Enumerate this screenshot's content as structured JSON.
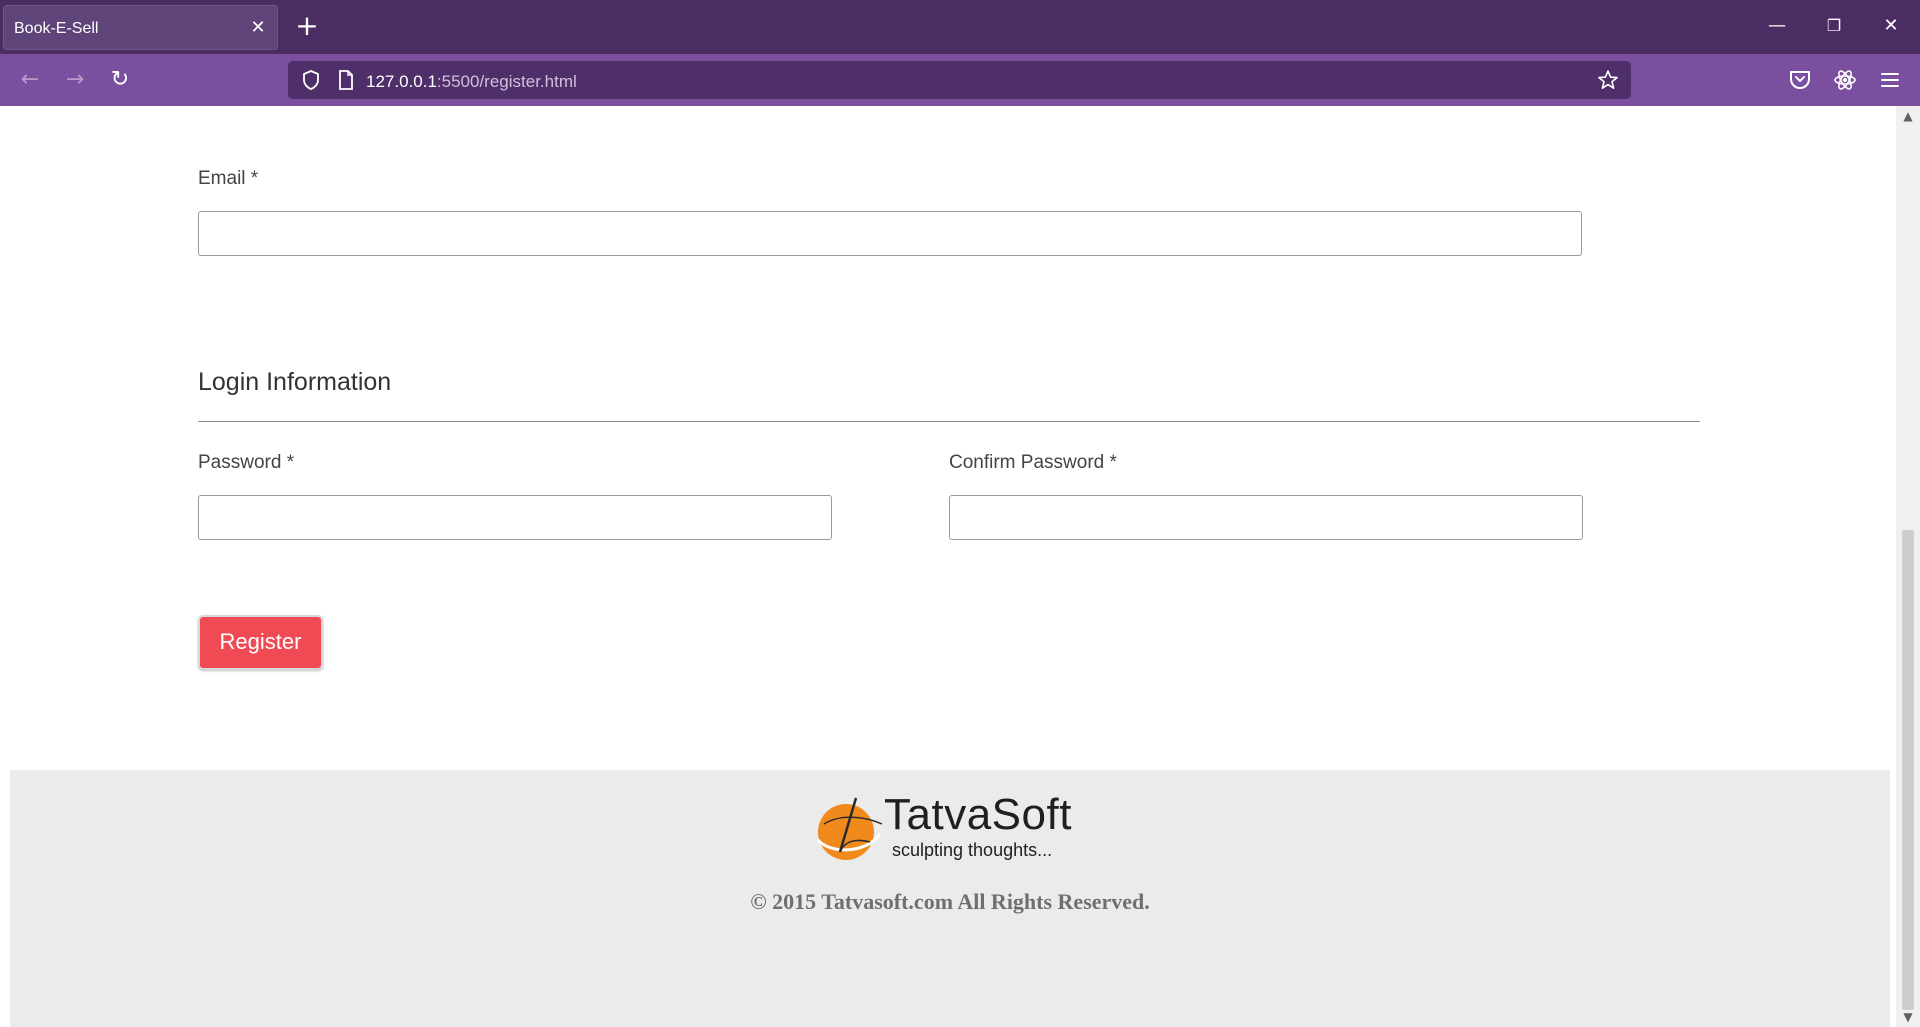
{
  "browser": {
    "tab_title": "Book-E-Sell",
    "tab_close": "✕",
    "new_tab": "+",
    "url_host": "127.0.0.1",
    "url_path": ":5500/register.html",
    "back_icon": "←",
    "forward_icon": "→",
    "reload_icon": "↻",
    "minimize_icon": "—",
    "restore_icon": "❐",
    "close_icon": "✕"
  },
  "form": {
    "email_label": "Email *",
    "email_value": "",
    "login_section_title": "Login Information",
    "password_label": "Password *",
    "password_value": "",
    "confirm_password_label": "Confirm Password *",
    "confirm_password_value": "",
    "register_button": "Register"
  },
  "footer": {
    "logo_name": "TatvaSoft",
    "logo_tagline": "sculpting thoughts...",
    "copyright": "© 2015 Tatvasoft.com All Rights Reserved."
  },
  "colors": {
    "titlebar": "#4a2d63",
    "navbar": "#7a4fa0",
    "register_button": "#f04a55",
    "footer_bg": "#ebebeb",
    "logo_orange": "#f08a1c"
  }
}
